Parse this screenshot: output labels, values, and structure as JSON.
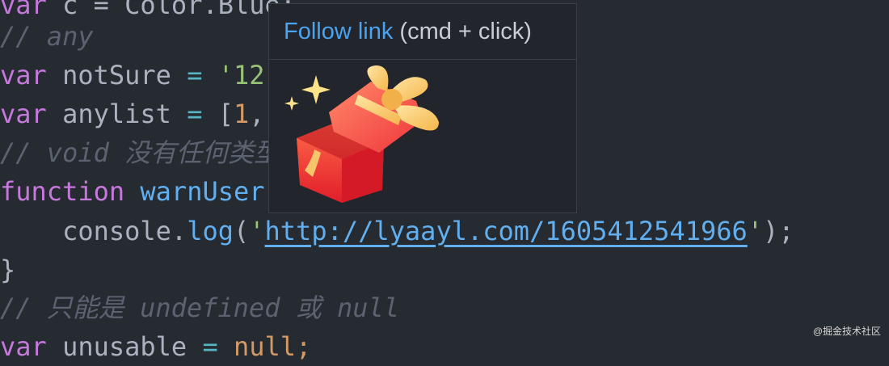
{
  "editor": {
    "lines": {
      "l0": {
        "kw": "var",
        "rest": " c = Color.Blue;"
      },
      "l1": {
        "comment": "// any"
      },
      "l2": {
        "kw": "var",
        "name": " notSure ",
        "eq": "=",
        "sp": " ",
        "val": "'12"
      },
      "l3": {
        "kw": "var",
        "name": " anylist ",
        "eq": "=",
        "sp": " ",
        "open": "[",
        "num": "1",
        "sep": ","
      },
      "l4": {
        "comment": "// void 没有任何类型"
      },
      "l5": {
        "kw": "function",
        "sp": " ",
        "fn": "warnUser"
      },
      "l6": {
        "indent": "    ",
        "obj": "console.",
        "method": "log",
        "paren": "(",
        "q1": "'",
        "url": "http://lyaayl.com/1605412541966",
        "q2": "'",
        "end": ");"
      },
      "l7": {
        "brace": "}"
      },
      "l8": {
        "comment": "// 只能是 undefined 或 null"
      },
      "l9": {
        "kw": "var",
        "name": " unusable",
        "eq": " = ",
        "val": "null;"
      }
    }
  },
  "hover": {
    "link_label": "Follow link",
    "hint": " (cmd + click)"
  },
  "watermark": "@掘金技术社区"
}
